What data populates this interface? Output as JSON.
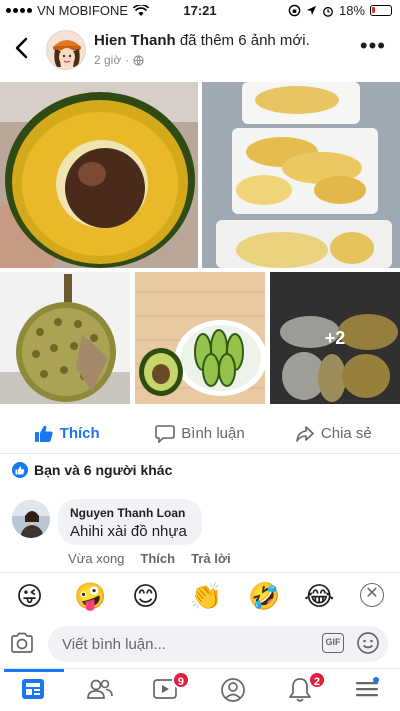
{
  "status_bar": {
    "carrier": "VN MOBIFONE",
    "time": "17:21",
    "battery": "18%"
  },
  "post": {
    "author": "Hien Thanh",
    "action_text": "đã thêm 6 ảnh mới.",
    "time": "2 giờ",
    "more_photos_label": "+2"
  },
  "actions": {
    "like": "Thích",
    "comment": "Bình luận",
    "share": "Chia sẻ"
  },
  "reactions": {
    "summary": "Bạn và 6 người khác"
  },
  "comment": {
    "author": "Nguyen Thanh Loan",
    "text": "Ahihi xài đồ nhựa",
    "time": "Vừa xong",
    "like_label": "Thích",
    "reply_label": "Trả lời"
  },
  "emoji_bar": {
    "emojis": [
      "😜",
      "🤪",
      "😊",
      "👏",
      "🤣",
      "😂"
    ]
  },
  "composer": {
    "placeholder": "Viết bình luận...",
    "gif_label": "GIF"
  },
  "tabbar": {
    "video_badge": "9",
    "notifications_badge": "2"
  },
  "colors": {
    "accent": "#1877f2",
    "badge": "#e41e3f"
  }
}
